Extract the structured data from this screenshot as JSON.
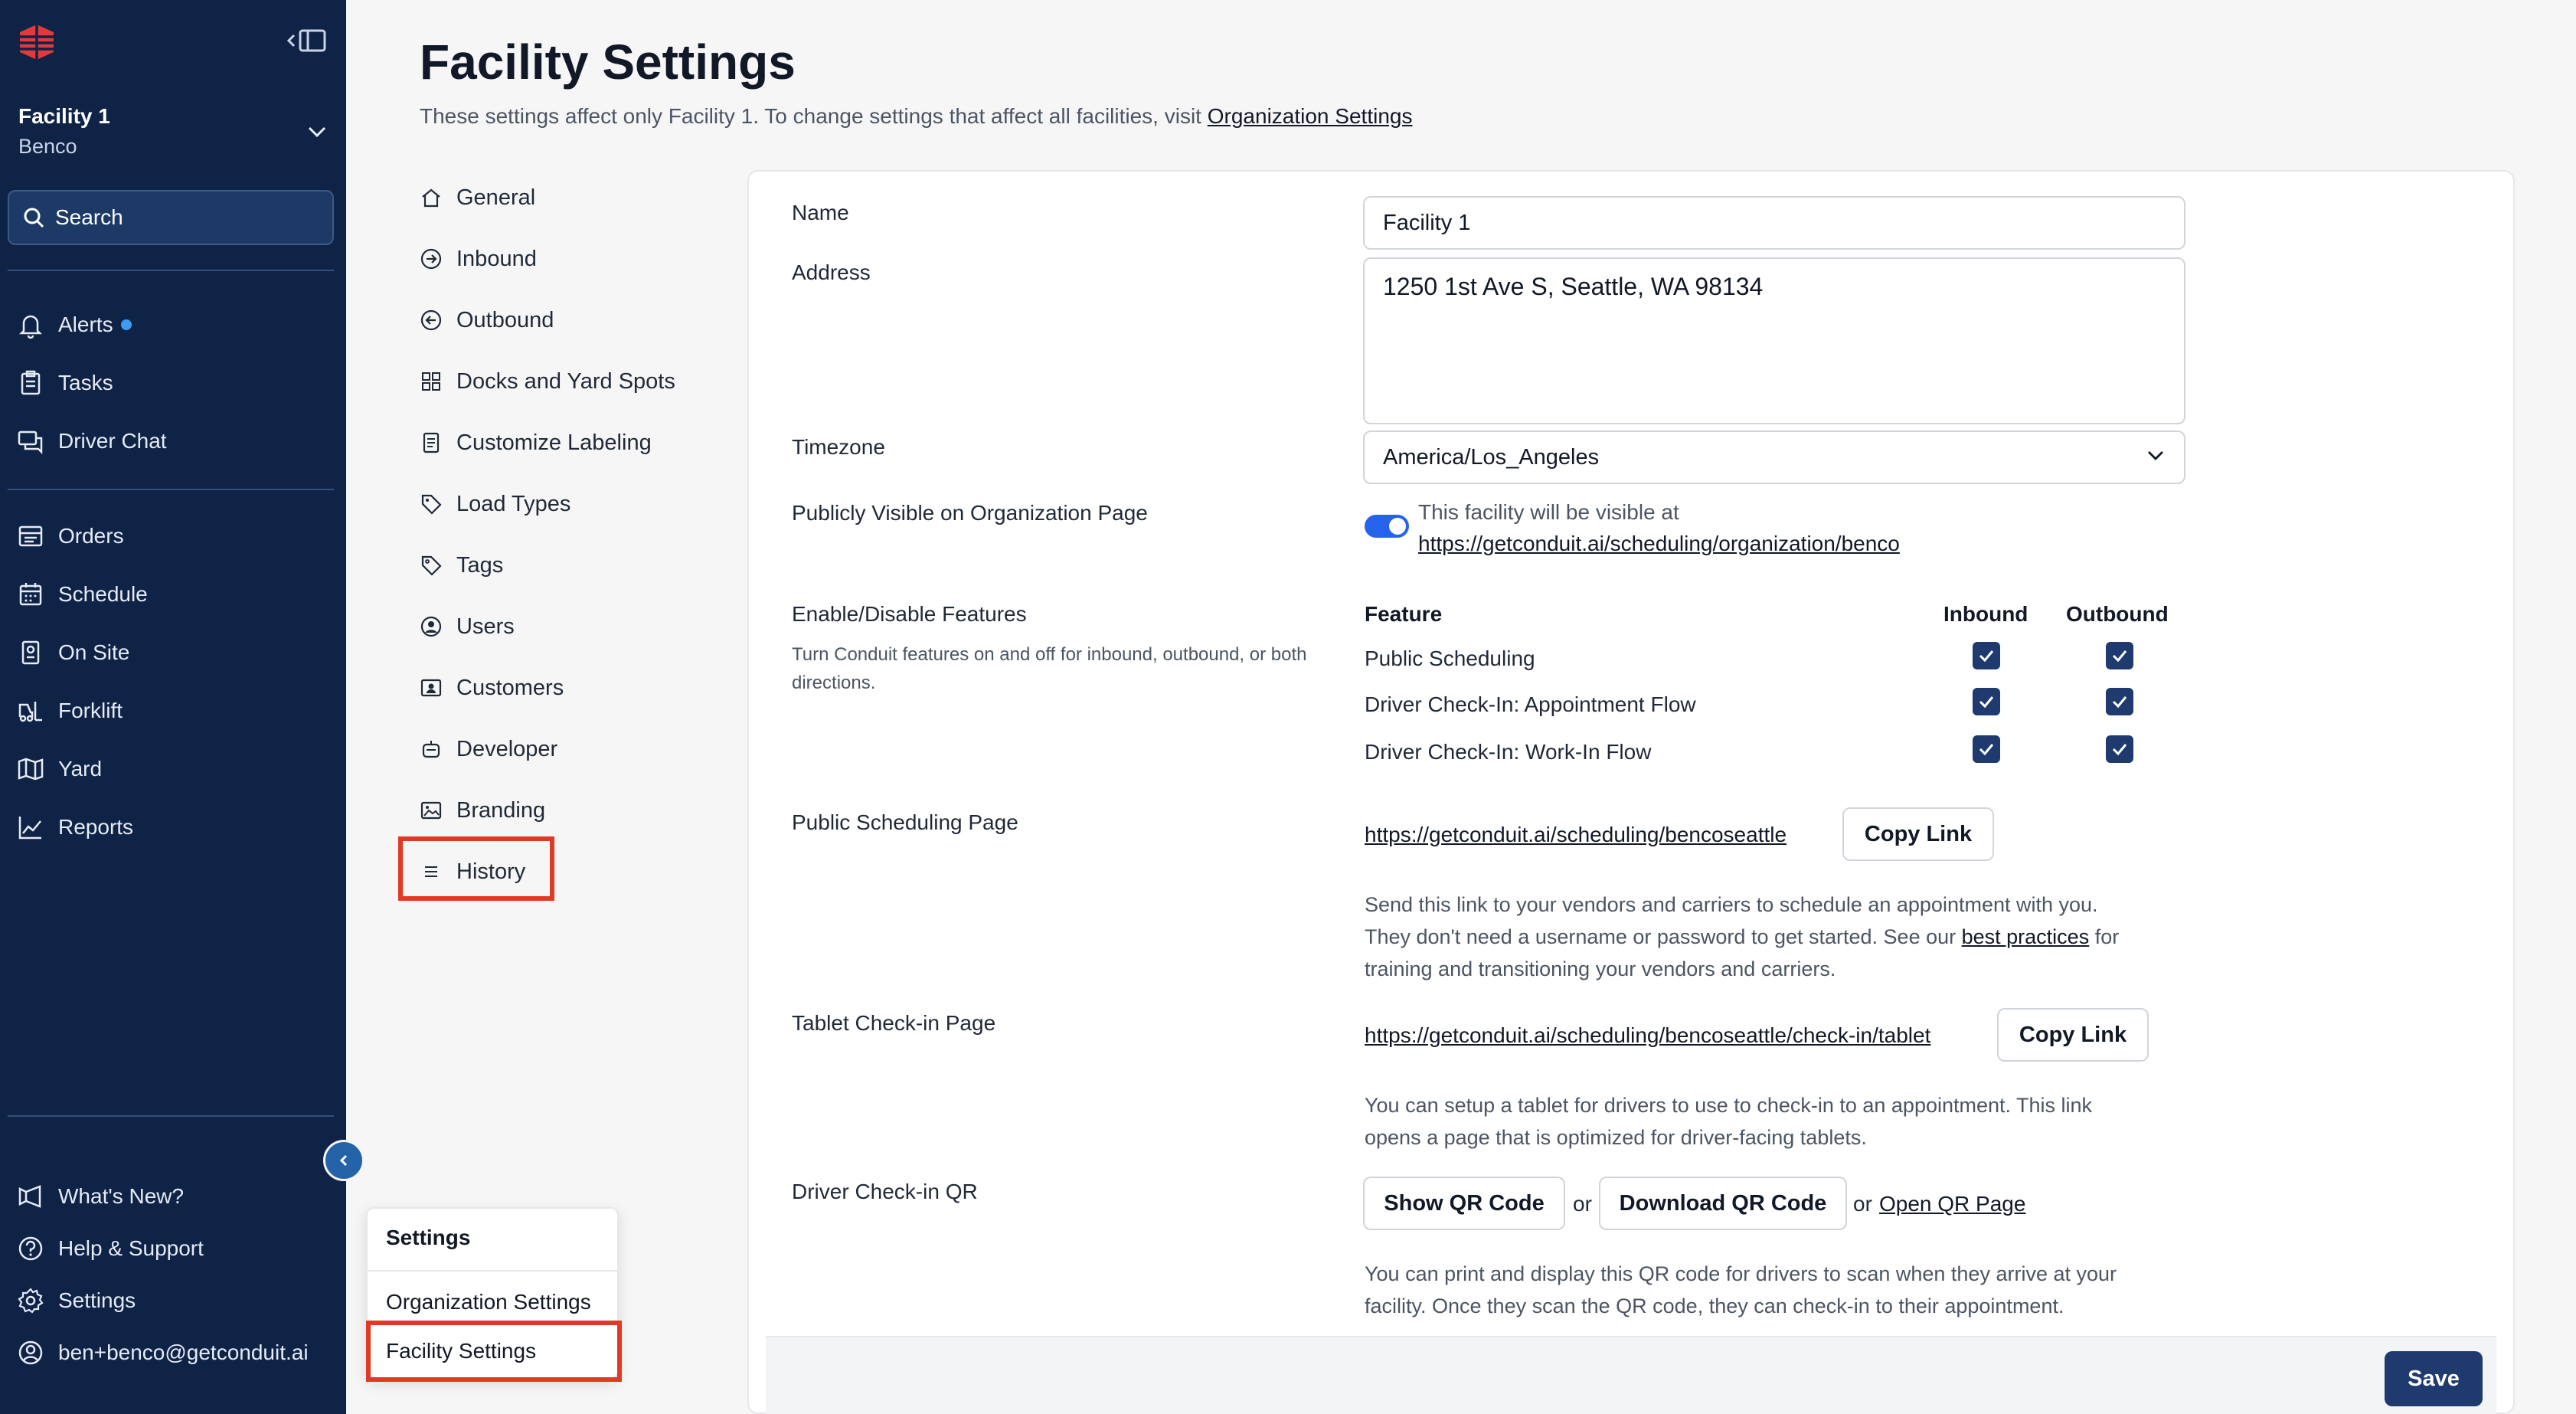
{
  "sidebar": {
    "facility_name": "Facility 1",
    "org_name": "Benco",
    "search_label": "Search",
    "nav_top": [
      {
        "label": "Alerts",
        "icon": "bell-icon"
      },
      {
        "label": "Tasks",
        "icon": "clipboard-icon"
      },
      {
        "label": "Driver Chat",
        "icon": "chat-icon"
      }
    ],
    "nav_main": [
      {
        "label": "Orders",
        "icon": "orders-icon"
      },
      {
        "label": "Schedule",
        "icon": "calendar-icon"
      },
      {
        "label": "On Site",
        "icon": "building-icon"
      },
      {
        "label": "Forklift",
        "icon": "forklift-icon"
      },
      {
        "label": "Yard",
        "icon": "map-icon"
      },
      {
        "label": "Reports",
        "icon": "chart-icon"
      }
    ],
    "nav_bottom": [
      {
        "label": "What's New?",
        "icon": "megaphone-icon"
      },
      {
        "label": "Help & Support",
        "icon": "question-icon"
      },
      {
        "label": "Settings",
        "icon": "gear-icon"
      },
      {
        "label": "ben+benco@getconduit.ai",
        "icon": "user-circle-icon"
      }
    ]
  },
  "header": {
    "title": "Facility Settings",
    "subtitle": "These settings affect only Facility 1. To change settings that affect all facilities, visit ",
    "subtitle_link": "Organization Settings"
  },
  "settings_nav": [
    {
      "label": "General",
      "icon": "home-icon"
    },
    {
      "label": "Inbound",
      "icon": "arrow-in-icon"
    },
    {
      "label": "Outbound",
      "icon": "arrow-out-icon"
    },
    {
      "label": "Docks and Yard Spots",
      "icon": "grid-icon"
    },
    {
      "label": "Customize Labeling",
      "icon": "document-icon"
    },
    {
      "label": "Load Types",
      "icon": "tag-icon"
    },
    {
      "label": "Tags",
      "icon": "tag-outline-icon"
    },
    {
      "label": "Users",
      "icon": "user-icon"
    },
    {
      "label": "Customers",
      "icon": "contact-card-icon"
    },
    {
      "label": "Developer",
      "icon": "bot-icon"
    },
    {
      "label": "Branding",
      "icon": "image-icon"
    },
    {
      "label": "History",
      "icon": "list-icon"
    }
  ],
  "form": {
    "name_label": "Name",
    "name_value": "Facility 1",
    "address_label": "Address",
    "address_value": "1250 1st Ave S, Seattle, WA 98134",
    "timezone_label": "Timezone",
    "timezone_value": "America/Los_Angeles",
    "visible_label": "Publicly Visible on Organization Page",
    "visible_on": true,
    "visible_text": "This facility will be visible at",
    "visible_link": "https://getconduit.ai/scheduling/organization/benco",
    "features_label": "Enable/Disable Features",
    "features_help": "Turn Conduit features on and off for inbound, outbound, or both directions.",
    "features_headers": {
      "feature": "Feature",
      "inbound": "Inbound",
      "outbound": "Outbound"
    },
    "features": [
      {
        "name": "Public Scheduling",
        "inbound": true,
        "outbound": true
      },
      {
        "name": "Driver Check-In: Appointment Flow",
        "inbound": true,
        "outbound": true
      },
      {
        "name": "Driver Check-In: Work-In Flow",
        "inbound": true,
        "outbound": true
      }
    ],
    "public_page_label": "Public Scheduling Page",
    "public_page_link": "https://getconduit.ai/scheduling/bencoseattle",
    "copy_link_label": "Copy Link",
    "public_page_help_1": "Send this link to your vendors and carriers to schedule an appointment with you.",
    "public_page_help_2a": "They don't need a username or password to get started. See our ",
    "public_page_help_link": "best practices",
    "public_page_help_2b": " for",
    "public_page_help_3": "training and transitioning your vendors and carriers.",
    "tablet_label": "Tablet Check-in Page",
    "tablet_link": "https://getconduit.ai/scheduling/bencoseattle/check-in/tablet",
    "tablet_help_1": "You can setup a tablet for drivers to use to check-in to an appointment. This link",
    "tablet_help_2": "opens a page that is optimized for driver-facing tablets.",
    "qr_label": "Driver Check-in QR",
    "show_qr": "Show QR Code",
    "or_text": "or",
    "download_qr": "Download QR Code",
    "open_qr": "Open QR Page",
    "qr_help_1": "You can print and display this QR code for drivers to scan when they arrive at your",
    "qr_help_2": "facility. Once they scan the QR code, they can check-in to their appointment.",
    "save_label": "Save"
  },
  "popup": {
    "title": "Settings",
    "items": [
      "Organization Settings",
      "Facility Settings"
    ]
  },
  "colors": {
    "sidebar_bg": "#0f2347",
    "accent": "#1e3a6e",
    "highlight_border": "#e03a24",
    "alert_dot": "#3b9bf5"
  }
}
